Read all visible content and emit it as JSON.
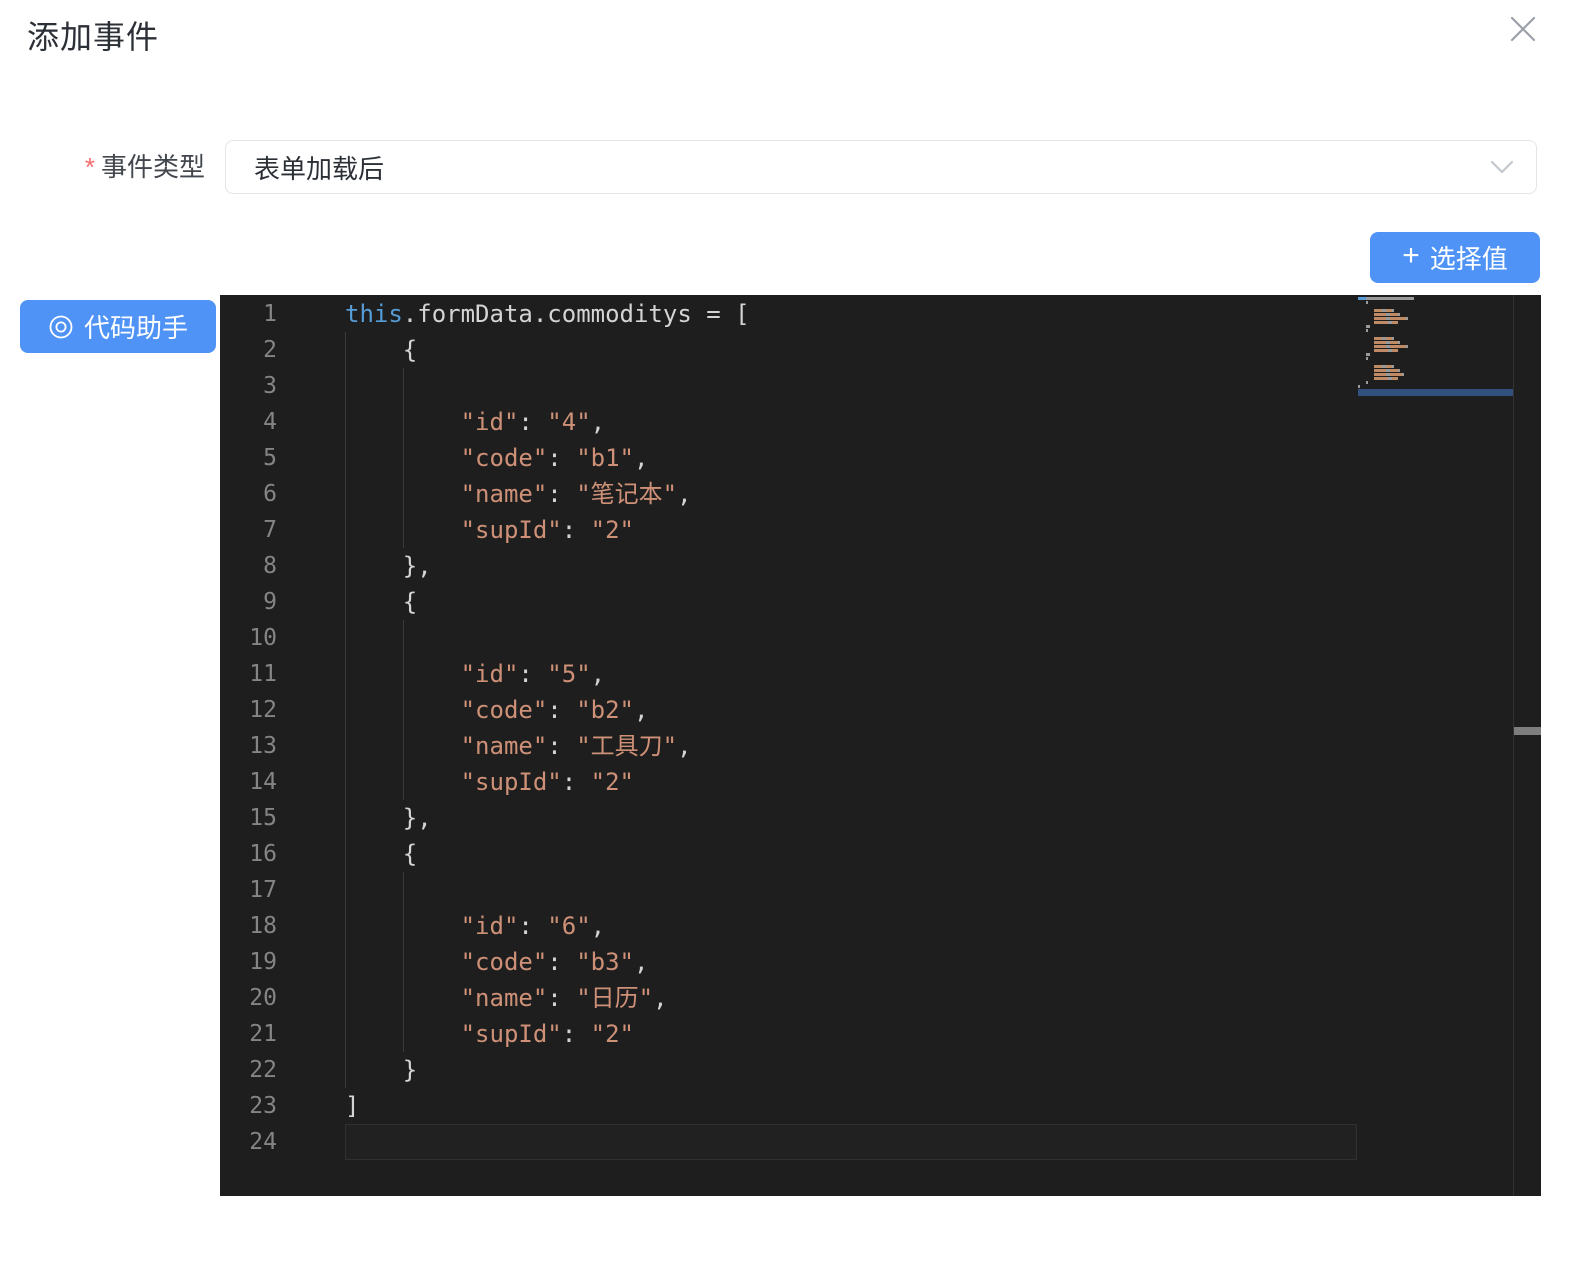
{
  "dialog": {
    "title": "添加事件"
  },
  "form": {
    "required_mark": "*",
    "event_type_label": "事件类型",
    "event_type_value": "表单加载后"
  },
  "toolbar": {
    "plus_icon": "+",
    "select_value_label": "选择值",
    "code_assistant_label": "代码助手"
  },
  "colors": {
    "accent_blue": "#4f93f6",
    "editor_background": "#1e1e1e",
    "token_keyword": "#569cd6",
    "token_foreground": "#d4d4d4",
    "token_string": "#ce9178",
    "line_number": "#858585",
    "required_red": "#f56c6c"
  },
  "editor": {
    "current_line": 24,
    "lines": [
      {
        "num": 1,
        "guides": [],
        "tokens": [
          {
            "t": "this",
            "c": "kw"
          },
          {
            "t": ".formData.commoditys = [",
            "c": "fg"
          }
        ]
      },
      {
        "num": 2,
        "guides": [
          0
        ],
        "tokens": [
          {
            "t": "    ",
            "c": "ws"
          },
          {
            "t": "{",
            "c": "fg"
          }
        ]
      },
      {
        "num": 3,
        "guides": [
          0,
          4
        ],
        "tokens": []
      },
      {
        "num": 4,
        "guides": [
          0,
          4
        ],
        "tokens": [
          {
            "t": "        ",
            "c": "ws"
          },
          {
            "t": "\"id\"",
            "c": "str"
          },
          {
            "t": ": ",
            "c": "fg"
          },
          {
            "t": "\"4\"",
            "c": "str"
          },
          {
            "t": ",",
            "c": "fg"
          }
        ]
      },
      {
        "num": 5,
        "guides": [
          0,
          4
        ],
        "tokens": [
          {
            "t": "        ",
            "c": "ws"
          },
          {
            "t": "\"code\"",
            "c": "str"
          },
          {
            "t": ": ",
            "c": "fg"
          },
          {
            "t": "\"b1\"",
            "c": "str"
          },
          {
            "t": ",",
            "c": "fg"
          }
        ]
      },
      {
        "num": 6,
        "guides": [
          0,
          4
        ],
        "tokens": [
          {
            "t": "        ",
            "c": "ws"
          },
          {
            "t": "\"name\"",
            "c": "str"
          },
          {
            "t": ": ",
            "c": "fg"
          },
          {
            "t": "\"笔记本\"",
            "c": "str"
          },
          {
            "t": ",",
            "c": "fg"
          }
        ]
      },
      {
        "num": 7,
        "guides": [
          0,
          4
        ],
        "tokens": [
          {
            "t": "        ",
            "c": "ws"
          },
          {
            "t": "\"supId\"",
            "c": "str"
          },
          {
            "t": ": ",
            "c": "fg"
          },
          {
            "t": "\"2\"",
            "c": "str"
          }
        ]
      },
      {
        "num": 8,
        "guides": [
          0
        ],
        "tokens": [
          {
            "t": "    ",
            "c": "ws"
          },
          {
            "t": "},",
            "c": "fg"
          }
        ]
      },
      {
        "num": 9,
        "guides": [
          0
        ],
        "tokens": [
          {
            "t": "    ",
            "c": "ws"
          },
          {
            "t": "{",
            "c": "fg"
          }
        ]
      },
      {
        "num": 10,
        "guides": [
          0,
          4
        ],
        "tokens": []
      },
      {
        "num": 11,
        "guides": [
          0,
          4
        ],
        "tokens": [
          {
            "t": "        ",
            "c": "ws"
          },
          {
            "t": "\"id\"",
            "c": "str"
          },
          {
            "t": ": ",
            "c": "fg"
          },
          {
            "t": "\"5\"",
            "c": "str"
          },
          {
            "t": ",",
            "c": "fg"
          }
        ]
      },
      {
        "num": 12,
        "guides": [
          0,
          4
        ],
        "tokens": [
          {
            "t": "        ",
            "c": "ws"
          },
          {
            "t": "\"code\"",
            "c": "str"
          },
          {
            "t": ": ",
            "c": "fg"
          },
          {
            "t": "\"b2\"",
            "c": "str"
          },
          {
            "t": ",",
            "c": "fg"
          }
        ]
      },
      {
        "num": 13,
        "guides": [
          0,
          4
        ],
        "tokens": [
          {
            "t": "        ",
            "c": "ws"
          },
          {
            "t": "\"name\"",
            "c": "str"
          },
          {
            "t": ": ",
            "c": "fg"
          },
          {
            "t": "\"工具刀\"",
            "c": "str"
          },
          {
            "t": ",",
            "c": "fg"
          }
        ]
      },
      {
        "num": 14,
        "guides": [
          0,
          4
        ],
        "tokens": [
          {
            "t": "        ",
            "c": "ws"
          },
          {
            "t": "\"supId\"",
            "c": "str"
          },
          {
            "t": ": ",
            "c": "fg"
          },
          {
            "t": "\"2\"",
            "c": "str"
          }
        ]
      },
      {
        "num": 15,
        "guides": [
          0
        ],
        "tokens": [
          {
            "t": "    ",
            "c": "ws"
          },
          {
            "t": "},",
            "c": "fg"
          }
        ]
      },
      {
        "num": 16,
        "guides": [
          0
        ],
        "tokens": [
          {
            "t": "    ",
            "c": "ws"
          },
          {
            "t": "{",
            "c": "fg"
          }
        ]
      },
      {
        "num": 17,
        "guides": [
          0,
          4
        ],
        "tokens": []
      },
      {
        "num": 18,
        "guides": [
          0,
          4
        ],
        "tokens": [
          {
            "t": "        ",
            "c": "ws"
          },
          {
            "t": "\"id\"",
            "c": "str"
          },
          {
            "t": ": ",
            "c": "fg"
          },
          {
            "t": "\"6\"",
            "c": "str"
          },
          {
            "t": ",",
            "c": "fg"
          }
        ]
      },
      {
        "num": 19,
        "guides": [
          0,
          4
        ],
        "tokens": [
          {
            "t": "        ",
            "c": "ws"
          },
          {
            "t": "\"code\"",
            "c": "str"
          },
          {
            "t": ": ",
            "c": "fg"
          },
          {
            "t": "\"b3\"",
            "c": "str"
          },
          {
            "t": ",",
            "c": "fg"
          }
        ]
      },
      {
        "num": 20,
        "guides": [
          0,
          4
        ],
        "tokens": [
          {
            "t": "        ",
            "c": "ws"
          },
          {
            "t": "\"name\"",
            "c": "str"
          },
          {
            "t": ": ",
            "c": "fg"
          },
          {
            "t": "\"日历\"",
            "c": "str"
          },
          {
            "t": ",",
            "c": "fg"
          }
        ]
      },
      {
        "num": 21,
        "guides": [
          0,
          4
        ],
        "tokens": [
          {
            "t": "        ",
            "c": "ws"
          },
          {
            "t": "\"supId\"",
            "c": "str"
          },
          {
            "t": ": ",
            "c": "fg"
          },
          {
            "t": "\"2\"",
            "c": "str"
          }
        ]
      },
      {
        "num": 22,
        "guides": [
          0
        ],
        "tokens": [
          {
            "t": "    ",
            "c": "ws"
          },
          {
            "t": "}",
            "c": "fg"
          }
        ]
      },
      {
        "num": 23,
        "guides": [],
        "tokens": [
          {
            "t": "]",
            "c": "fg"
          }
        ]
      },
      {
        "num": 24,
        "guides": [],
        "tokens": []
      }
    ]
  }
}
